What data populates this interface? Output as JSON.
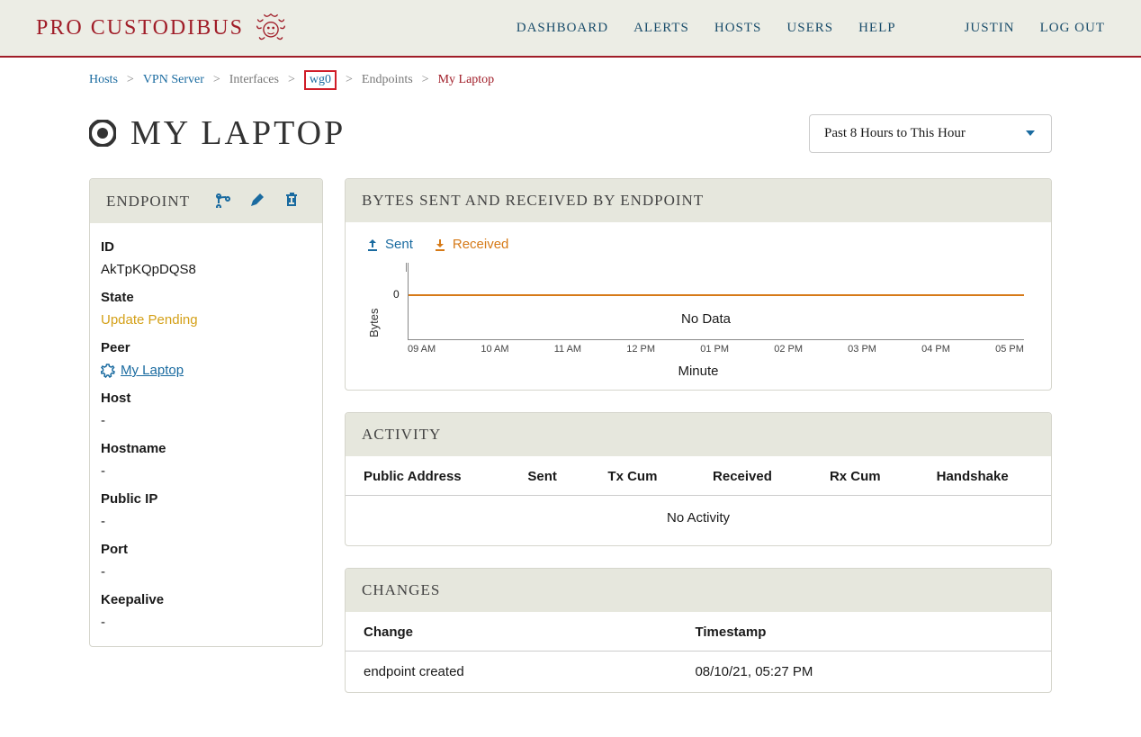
{
  "brand": "PRO CUSTODIBUS",
  "nav": {
    "dashboard": "DASHBOARD",
    "alerts": "ALERTS",
    "hosts": "HOSTS",
    "users": "USERS",
    "help": "HELP",
    "user": "JUSTIN",
    "logout": "LOG OUT"
  },
  "breadcrumb": {
    "hosts": "Hosts",
    "vpn_server": "VPN Server",
    "interfaces": "Interfaces",
    "wg0": "wg0",
    "endpoints": "Endpoints",
    "current": "My Laptop"
  },
  "page": {
    "title": "MY LAPTOP"
  },
  "time_select": "Past 8 Hours to This Hour",
  "endpoint_panel": {
    "heading": "ENDPOINT",
    "labels": {
      "id": "ID",
      "state": "State",
      "peer": "Peer",
      "host": "Host",
      "hostname": "Hostname",
      "public_ip": "Public IP",
      "port": "Port",
      "keepalive": "Keepalive"
    },
    "values": {
      "id": "AkTpKQpDQS8",
      "state": "Update Pending",
      "peer": "My Laptop",
      "host": "-",
      "hostname": "-",
      "public_ip": "-",
      "port": "-",
      "keepalive": "-"
    }
  },
  "bytes_panel": {
    "heading": "BYTES SENT AND RECEIVED BY ENDPOINT",
    "sent_label": "Sent",
    "received_label": "Received",
    "y_label": "Bytes",
    "x_label": "Minute",
    "zero": "0",
    "no_data": "No Data"
  },
  "chart_data": {
    "type": "line",
    "series": [
      {
        "name": "Sent",
        "values": []
      },
      {
        "name": "Received",
        "values": []
      }
    ],
    "x_ticks": [
      "09 AM",
      "10 AM",
      "11 AM",
      "12 PM",
      "01 PM",
      "02 PM",
      "03 PM",
      "04 PM",
      "05 PM"
    ],
    "ylabel": "Bytes",
    "xlabel": "Minute",
    "ylim": [
      0,
      0
    ],
    "note": "No Data"
  },
  "activity_panel": {
    "heading": "ACTIVITY",
    "columns": {
      "public_address": "Public Address",
      "sent": "Sent",
      "tx_cum": "Tx Cum",
      "received": "Received",
      "rx_cum": "Rx Cum",
      "handshake": "Handshake"
    },
    "no_activity": "No Activity"
  },
  "changes_panel": {
    "heading": "CHANGES",
    "columns": {
      "change": "Change",
      "timestamp": "Timestamp"
    },
    "rows": [
      {
        "change": "endpoint created",
        "timestamp": "08/10/21, 05:27 PM"
      }
    ]
  }
}
